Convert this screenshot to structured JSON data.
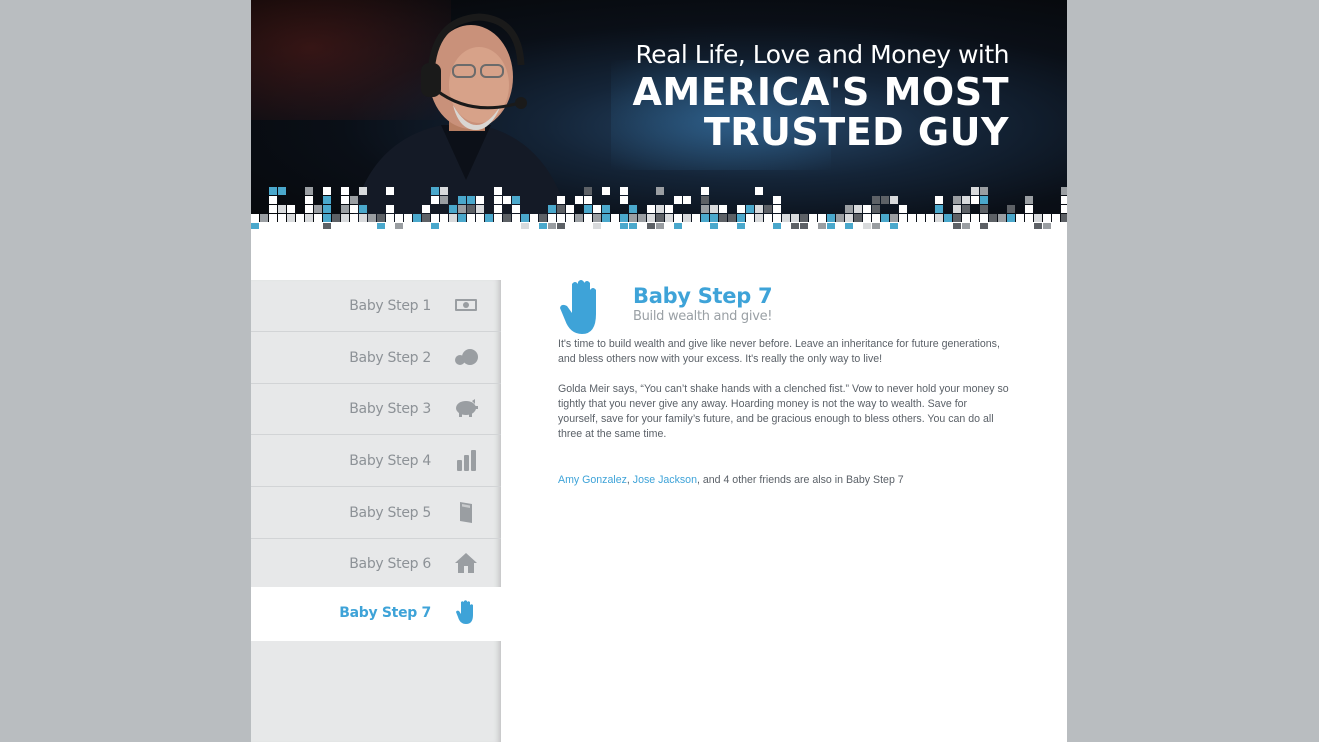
{
  "banner": {
    "subtitle": "Real Life, Love and Money with",
    "title_line1": "AMERICA'S MOST",
    "title_line2": "TRUSTED GUY"
  },
  "sidebar": {
    "items": [
      {
        "label": "Baby Step 1",
        "icon": "money-icon"
      },
      {
        "label": "Baby Step 2",
        "icon": "snowball-icon"
      },
      {
        "label": "Baby Step 3",
        "icon": "piggy-bank-icon"
      },
      {
        "label": "Baby Step 4",
        "icon": "bar-chart-icon"
      },
      {
        "label": "Baby Step 5",
        "icon": "book-icon"
      },
      {
        "label": "Baby Step 6",
        "icon": "house-icon"
      },
      {
        "label": "Baby Step 7",
        "icon": "hand-icon",
        "active": true
      }
    ]
  },
  "content": {
    "title": "Baby Step 7",
    "subtitle": "Build wealth and give!",
    "paragraph1": "It's time to build wealth and give like never before. Leave an inheritance for future generations, and bless others now with your excess. It's really the only way to live!",
    "paragraph2": "Golda Meir says, “You can’t shake hands with a clenched fist.” Vow to never hold your money so tightly that you never give any away. Hoarding money is not the way to wealth. Save for yourself, save for your family’s future, and be gracious enough to bless others. You can do all three at the same time.",
    "friend1": "Amy Gonzalez",
    "separator": ", ",
    "friend2": "Jose Jackson",
    "friends_suffix": ", and 4 other friends are also in Baby Step 7"
  },
  "colors": {
    "accent": "#3ea3d8",
    "sidebar_bg": "#e7e8e9",
    "page_bg": "#b9bdc0",
    "text": "#5b6168",
    "muted": "#8d9297"
  }
}
